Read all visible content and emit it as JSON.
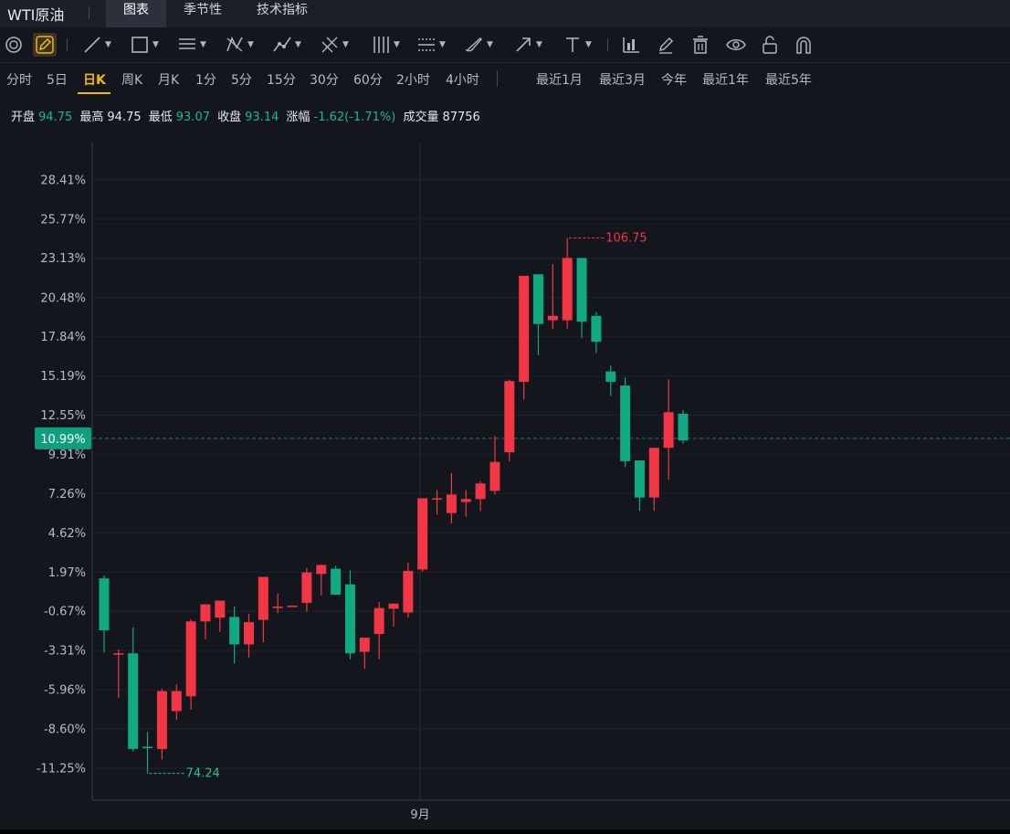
{
  "header": {
    "symbol": "WTI原油",
    "tabs": [
      "图表",
      "季节性",
      "技术指标"
    ],
    "active_tab": 0
  },
  "toolbar": {
    "tools": [
      {
        "icon": "magnet-circle-icon",
        "dropdown": false
      },
      {
        "icon": "pencil-edit-icon",
        "dropdown": false,
        "highlight": true
      },
      {
        "icon": "line-tool-icon",
        "dropdown": true
      },
      {
        "icon": "rectangle-tool-icon",
        "dropdown": true
      },
      {
        "icon": "parallel-lines-icon",
        "dropdown": true
      },
      {
        "icon": "pattern-tool-icon",
        "dropdown": true
      },
      {
        "icon": "wave-tool-icon",
        "dropdown": true
      },
      {
        "icon": "fib-tool-icon",
        "dropdown": true
      },
      {
        "icon": "gann-tool-icon",
        "dropdown": true
      },
      {
        "icon": "channel-tool-icon",
        "dropdown": true
      },
      {
        "icon": "brush-tool-icon",
        "dropdown": true
      },
      {
        "icon": "arrow-tool-icon",
        "dropdown": true
      },
      {
        "icon": "text-tool-icon",
        "dropdown": true
      },
      {
        "icon": "measure-icon",
        "dropdown": false
      },
      {
        "icon": "eraser-pen-icon",
        "dropdown": false
      },
      {
        "icon": "trash-icon",
        "dropdown": false
      },
      {
        "icon": "eye-icon",
        "dropdown": false
      },
      {
        "icon": "unlock-icon",
        "dropdown": false
      },
      {
        "icon": "magnet-icon",
        "dropdown": false
      }
    ]
  },
  "periods": {
    "items": [
      "分时",
      "5日",
      "日K",
      "周K",
      "月K",
      "1分",
      "5分",
      "15分",
      "30分",
      "60分",
      "2小时",
      "4小时"
    ],
    "active": 2,
    "ranges": [
      "最近1月",
      "最近3月",
      "今年",
      "最近1年",
      "最近5年"
    ]
  },
  "ohlc": {
    "open_label": "开盘",
    "open": "94.75",
    "high_label": "最高",
    "high": "94.75",
    "low_label": "最低",
    "low": "93.07",
    "close_label": "收盘",
    "close": "93.14",
    "change_label": "涨幅",
    "change": "-1.62(-1.71%)",
    "volume_label": "成交量",
    "volume": "87756"
  },
  "chart_data": {
    "type": "candlestick",
    "y_axis_unit": "percent",
    "y_ticks": [
      "28.41%",
      "25.77%",
      "23.13%",
      "20.48%",
      "17.84%",
      "15.19%",
      "12.55%",
      "9.91%",
      "7.26%",
      "4.62%",
      "1.97%",
      "-0.67%",
      "-3.31%",
      "-5.96%",
      "-8.60%",
      "-11.25%"
    ],
    "ylim": [
      -12.5,
      30.0
    ],
    "x_label": "9月",
    "current_value_label": "10.99%",
    "current_value": 10.99,
    "max_marker": "106.75",
    "min_marker": "74.24",
    "up_color": "#f23645",
    "down_color": "#0fa982",
    "candles": [
      {
        "o": 1.55,
        "h": 1.75,
        "l": -3.45,
        "c": -1.95
      },
      {
        "o": -3.5,
        "h": -3.25,
        "l": -6.5,
        "c": -3.5
      },
      {
        "o": -3.5,
        "h": -1.75,
        "l": -10.1,
        "c": -9.95
      },
      {
        "o": -9.8,
        "h": -8.8,
        "l": -11.6,
        "c": -9.9
      },
      {
        "o": -9.95,
        "h": -5.9,
        "l": -10.65,
        "c": -6.05
      },
      {
        "o": -7.4,
        "h": -5.6,
        "l": -8.0,
        "c": -6.05
      },
      {
        "o": -6.4,
        "h": -1.2,
        "l": -7.3,
        "c": -1.35
      },
      {
        "o": -1.35,
        "h": -0.7,
        "l": -2.55,
        "c": -0.2
      },
      {
        "o": -1.1,
        "h": -0.15,
        "l": -2.05,
        "c": 0.05
      },
      {
        "o": -1.05,
        "h": -0.35,
        "l": -4.2,
        "c": -2.9
      },
      {
        "o": -2.9,
        "h": -0.85,
        "l": -3.8,
        "c": -1.4
      },
      {
        "o": -1.25,
        "h": 0.85,
        "l": -2.75,
        "c": 1.65
      },
      {
        "o": -0.45,
        "h": 0.55,
        "l": -0.8,
        "c": -0.35
      },
      {
        "o": -0.3,
        "h": -0.25,
        "l": -0.35,
        "c": -0.3
      },
      {
        "o": -0.1,
        "h": 2.25,
        "l": -0.7,
        "c": 1.95
      },
      {
        "o": 1.85,
        "h": 2.5,
        "l": 0.4,
        "c": 2.45
      },
      {
        "o": 2.2,
        "h": 2.4,
        "l": 0.6,
        "c": 0.45
      },
      {
        "o": 1.15,
        "h": 2.1,
        "l": -3.9,
        "c": -3.5
      },
      {
        "o": -3.4,
        "h": -3.4,
        "l": -4.55,
        "c": -2.45
      },
      {
        "o": -2.2,
        "h": -0.05,
        "l": -3.9,
        "c": -0.45
      },
      {
        "o": -0.5,
        "h": -0.2,
        "l": -1.7,
        "c": -0.15
      },
      {
        "o": -0.75,
        "h": 2.6,
        "l": -1.1,
        "c": 2.05
      },
      {
        "o": 2.15,
        "h": 6.3,
        "l": 2.0,
        "c": 6.95
      },
      {
        "o": 6.9,
        "h": 7.5,
        "l": 5.85,
        "c": 6.95
      },
      {
        "o": 5.95,
        "h": 8.65,
        "l": 5.25,
        "c": 7.2
      },
      {
        "o": 6.7,
        "h": 7.5,
        "l": 5.7,
        "c": 6.9
      },
      {
        "o": 6.9,
        "h": 8.1,
        "l": 6.1,
        "c": 7.95
      },
      {
        "o": 7.45,
        "h": 11.15,
        "l": 7.2,
        "c": 9.4
      },
      {
        "o": 10.05,
        "h": 14.95,
        "l": 9.45,
        "c": 14.85
      },
      {
        "o": 14.8,
        "h": 21.8,
        "l": 13.6,
        "c": 21.95
      },
      {
        "o": 22.05,
        "h": 22.05,
        "l": 16.6,
        "c": 18.7
      },
      {
        "o": 18.95,
        "h": 22.75,
        "l": 18.35,
        "c": 19.25
      },
      {
        "o": 18.95,
        "h": 24.5,
        "l": 18.4,
        "c": 23.15
      },
      {
        "o": 23.15,
        "h": 23.15,
        "l": 17.75,
        "c": 18.85
      },
      {
        "o": 19.25,
        "h": 19.5,
        "l": 16.75,
        "c": 17.5
      },
      {
        "o": 15.5,
        "h": 15.9,
        "l": 13.85,
        "c": 14.8
      },
      {
        "o": 14.55,
        "h": 15.1,
        "l": 9.05,
        "c": 9.45
      },
      {
        "o": 9.5,
        "h": 9.5,
        "l": 6.1,
        "c": 7.0
      },
      {
        "o": 7.0,
        "h": 10.25,
        "l": 6.1,
        "c": 10.35
      },
      {
        "o": 10.35,
        "h": 14.95,
        "l": 8.2,
        "c": 12.75
      },
      {
        "o": 12.65,
        "h": 12.9,
        "l": 10.65,
        "c": 10.85
      }
    ]
  }
}
